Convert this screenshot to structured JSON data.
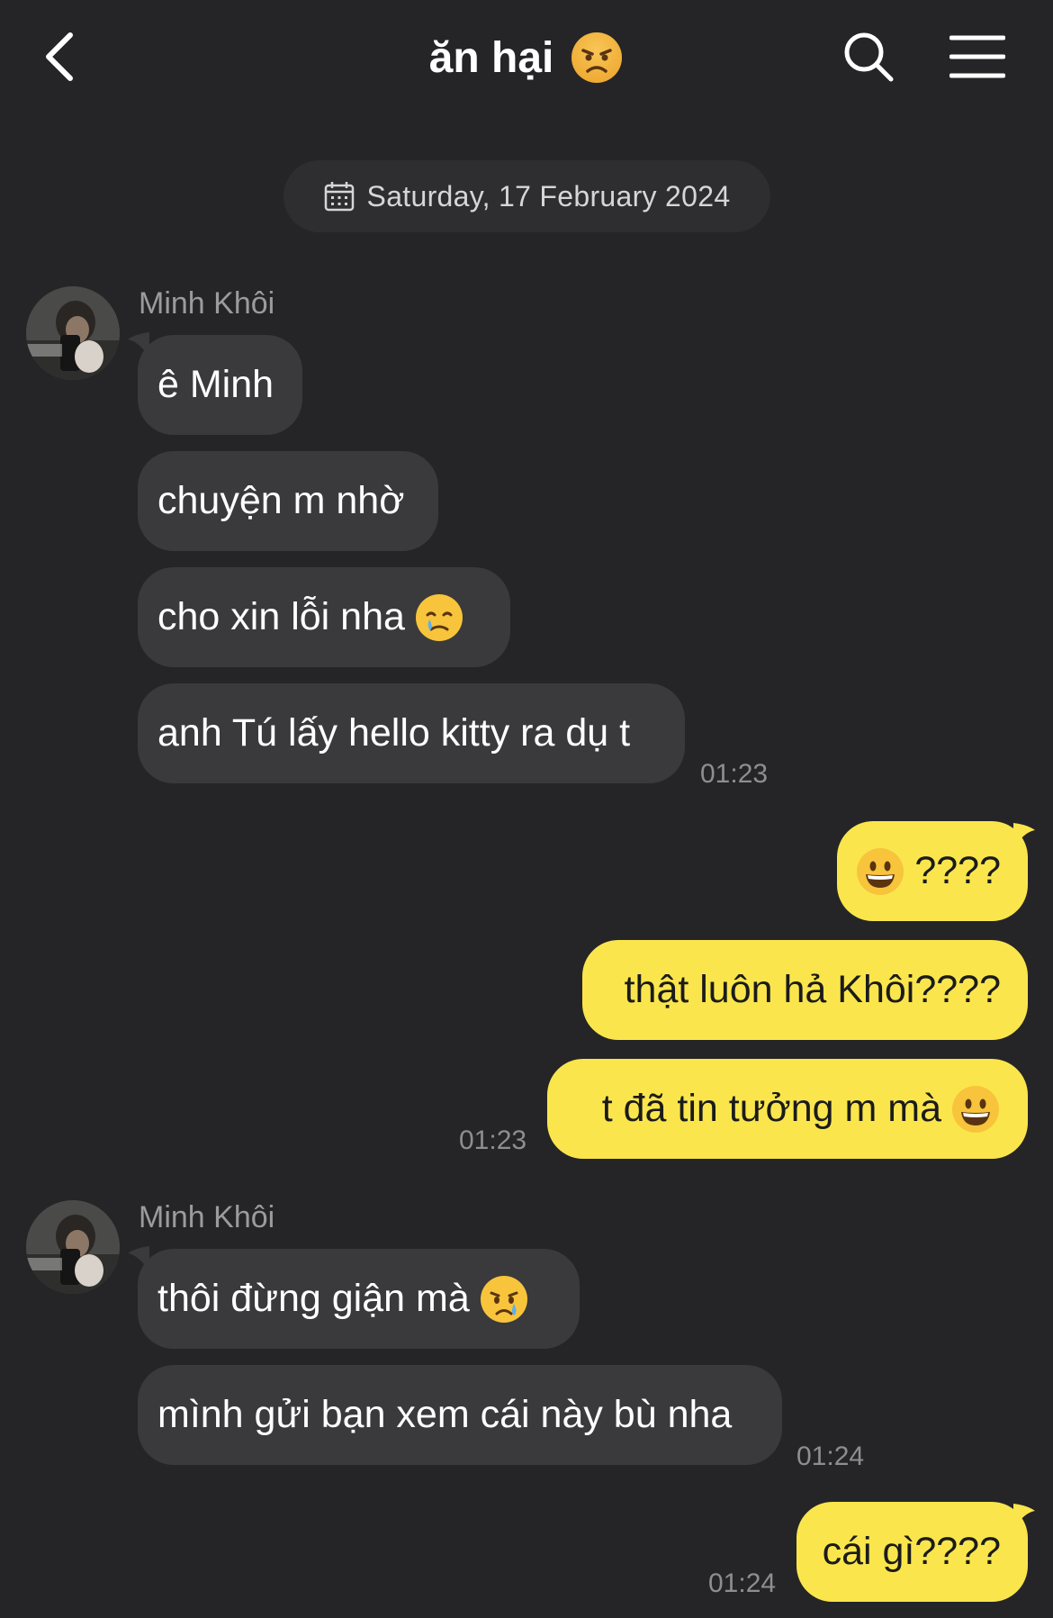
{
  "header": {
    "title": "ăn hại",
    "title_emoji": "angry-face-icon"
  },
  "date_label": "Saturday, 17 February 2024",
  "colors": {
    "background": "#252527",
    "incoming_bubble": "#3a3a3c",
    "outgoing_bubble": "#fae64c",
    "muted_text": "#8e8e92"
  },
  "messages": {
    "group1": {
      "sender": "Minh Khôi",
      "m1": "ê Minh",
      "m2": "chuyện m nhờ",
      "m3": "cho xin lỗi nha",
      "m4": "anh Tú lấy hello kitty ra dụ t",
      "time": "01:23"
    },
    "group2": {
      "m1": "????",
      "m2": "thật luôn hả Khôi????",
      "m3": "t đã tin tưởng m mà",
      "time": "01:23"
    },
    "group3": {
      "sender": "Minh Khôi",
      "m1": "thôi đừng giận mà",
      "m2": "mình gửi bạn xem cái này bù nha",
      "time": "01:24"
    },
    "group4": {
      "m1": "cái gì????",
      "time": "01:24"
    }
  }
}
